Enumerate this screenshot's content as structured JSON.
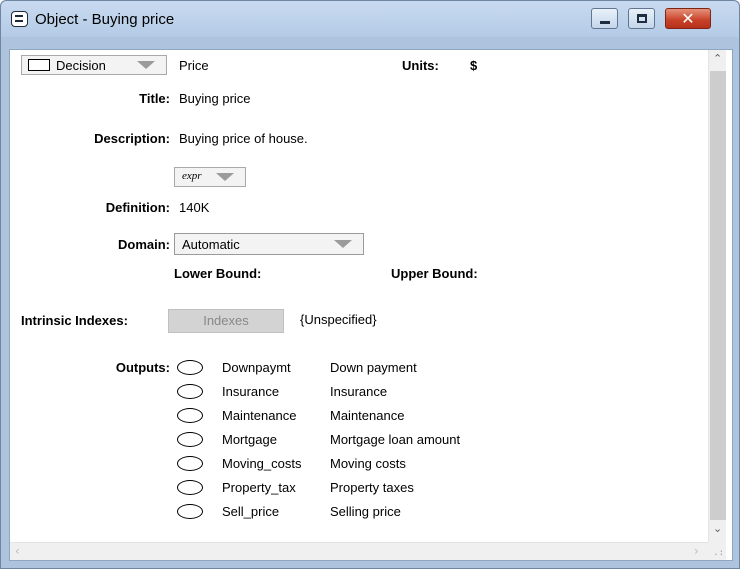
{
  "window": {
    "title": "Object - Buying price"
  },
  "header": {
    "class_value": "Decision",
    "identifier": "Price",
    "units_label": "Units:",
    "units_value": "$"
  },
  "fields": {
    "title_label": "Title:",
    "title_value": "Buying price",
    "description_label": "Description:",
    "description_value": "Buying price of house.",
    "expr_option": "expr",
    "definition_label": "Definition:",
    "definition_value": "140K",
    "domain_label": "Domain:",
    "domain_value": "Automatic",
    "lower_bound_label": "Lower Bound:",
    "upper_bound_label": "Upper Bound:",
    "intrinsic_label": "Intrinsic Indexes:",
    "indexes_button": "Indexes",
    "intrinsic_value": "{Unspecified}",
    "outputs_label": "Outputs:"
  },
  "outputs": [
    {
      "identifier": "Downpaymt",
      "title": "Down payment"
    },
    {
      "identifier": "Insurance",
      "title": "Insurance"
    },
    {
      "identifier": "Maintenance",
      "title": "Maintenance"
    },
    {
      "identifier": "Mortgage",
      "title": "Mortgage loan amount"
    },
    {
      "identifier": "Moving_costs",
      "title": "Moving costs"
    },
    {
      "identifier": "Property_tax",
      "title": "Property taxes"
    },
    {
      "identifier": "Sell_price",
      "title": "Selling  price"
    }
  ],
  "icons": {
    "app": "object-window-icon",
    "minimize": "minimize-icon",
    "maximize": "maximize-icon",
    "close": "close-icon",
    "node": "variable-node-icon"
  },
  "colors": {
    "frame": "#aec4de",
    "close_button": "#c74128"
  }
}
